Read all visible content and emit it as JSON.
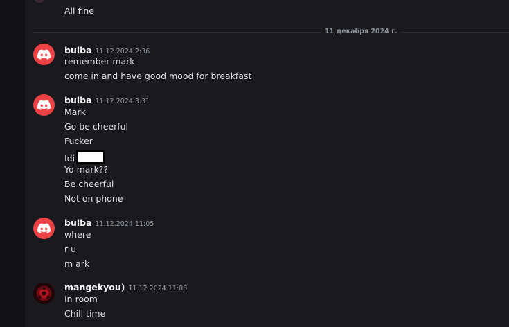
{
  "previous": {
    "lines": [
      "All fine"
    ]
  },
  "date_divider": "11 декабря 2024 г.",
  "messages": [
    {
      "username": "bulba",
      "timestamp": "11.12.2024 2:36",
      "avatar_icon": "discord-logo-icon",
      "avatar_color": "#ed4245",
      "lines": [
        "remember mark",
        "come in and have good mood for breakfast"
      ]
    },
    {
      "username": "bulba",
      "timestamp": "11.12.2024 3:31",
      "avatar_icon": "discord-logo-icon",
      "avatar_color": "#ed4245",
      "lines": [
        "Mark",
        "Go be cheerful",
        "Fucker",
        "Idi",
        "Yo mark??",
        "Be cheerful",
        "Not on phone"
      ]
    },
    {
      "username": "bulba",
      "timestamp": "11.12.2024 11:05",
      "avatar_icon": "discord-logo-icon",
      "avatar_color": "#ed4245",
      "lines": [
        "where",
        "r u",
        "m ark"
      ]
    },
    {
      "username": "mangekyou)",
      "timestamp": "11.12.2024 11:08",
      "avatar_icon": "sharingan-avatar-icon",
      "avatar_color": "#8b0f1a",
      "lines": [
        "In room",
        "Chill time"
      ]
    }
  ]
}
